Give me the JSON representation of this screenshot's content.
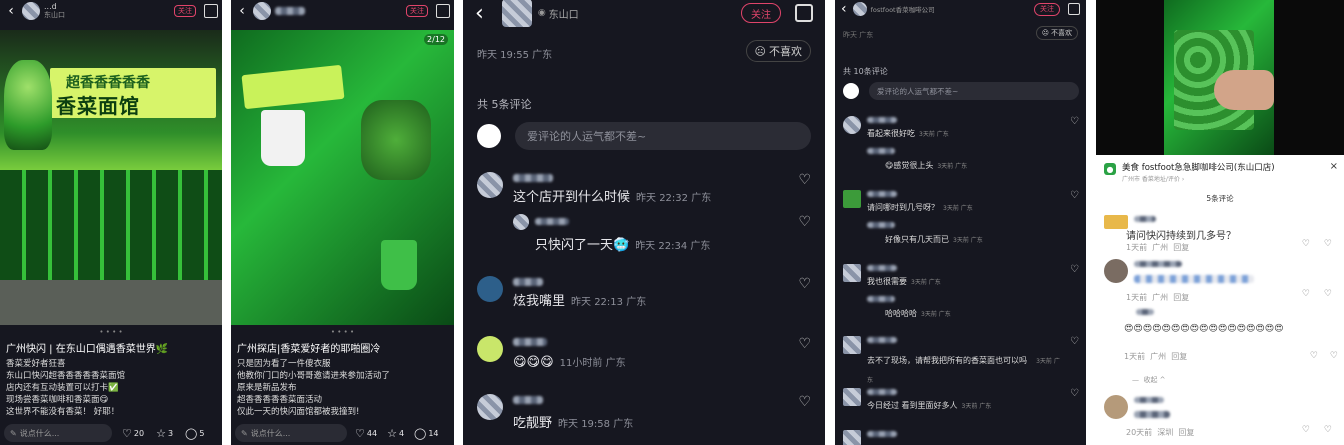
{
  "p1": {
    "username": "...d",
    "sub": "东山口",
    "follow": "关注",
    "sign_top": "超香香香香香",
    "sign_main": "香菜面馆",
    "caption_title": "广州快闪 | 在东山口偶遇香菜世界🌿",
    "lines": [
      "香菜爱好者狂喜",
      "东山口快闪超香香香香香菜面馆",
      "店内还有互动装置可以打卡✅",
      "现场尝香菜咖啡和香菜面😋",
      "这世界不能没有香菜！ 好耶！"
    ],
    "input": "说点什么...",
    "likes": "20",
    "stars": "3",
    "comments": "5"
  },
  "p2": {
    "follow": "关注",
    "page": "2/12",
    "caption_title": "广州探店|香菜爱好者的耶啪圈冷",
    "lines": [
      "只是因为看了一件傻衣服",
      "他教你门口的小哥哥邀请进来参加活动了",
      "原来是新品发布",
      "超香香香香香菜面活动",
      "仅此一天的快闪面馆都被我撞到!"
    ],
    "input": "说点什么...",
    "likes": "44",
    "stars": "4",
    "comments": "14"
  },
  "p3": {
    "location": "东山口",
    "follow": "关注",
    "time": "昨天 19:55 广东",
    "dislike": "不喜欢",
    "count": "共 5条评论",
    "placeholder": "爱评论的人运气都不差~",
    "comments": [
      {
        "text": "这个店开到什么时候",
        "meta": "昨天 22:32 广东"
      },
      {
        "text": "只快闪了一天🥶",
        "meta": "昨天 22:34 广东"
      },
      {
        "text": "炫我嘴里",
        "meta": "昨天 22:13 广东"
      },
      {
        "text": "😋😋😋",
        "meta": "11小时前 广东"
      },
      {
        "text": "吃靓野",
        "meta": "昨天 19:58 广东"
      }
    ]
  },
  "p4": {
    "follow": "关注",
    "dislike": "不喜欢",
    "title_line": "fostfoot香菜咖啡公司",
    "time": "昨天 广东",
    "count": "共 10条评论",
    "placeholder": "爱评论的人运气都不差~",
    "comments": [
      {
        "text": "看起来很好吃",
        "meta": "3天前 广东"
      },
      {
        "text": "😋感觉很上头",
        "meta": "3天前 广东"
      },
      {
        "text": "请问哪时到几号呀？",
        "meta": "3天前 广东"
      },
      {
        "text": "好像只有几天而已",
        "meta": "3天前 广东"
      },
      {
        "text": "我也很需要",
        "meta": "3天前 广东"
      },
      {
        "text": "哈哈哈哈",
        "meta": "3天前 广东"
      },
      {
        "text": "去不了现场，请帮我把所有的香菜面也可以吗",
        "meta": "3天前 广东"
      },
      {
        "text": "今日经过 看到里面好多人",
        "meta": "3天前 广东"
      }
    ]
  },
  "p5": {
    "shop": "美食  fostfoot急急脚咖啡公司(东山口店)",
    "shop_sub": "广州市  香菜地址/评价 ›",
    "count": "5条评论",
    "c1_text": "请问快闪持续到几多号？",
    "c1_meta": "1天前  广州  回复",
    "c2_meta": "1天前  广州  回复",
    "c3_text": "😍😍😍😍😍😍😍😍😍😍😍😍😍😍😍😍😍",
    "c3_meta": "1天前  广州  回复",
    "more": "—  收起 ^",
    "c4_meta": "20天前  深圳  回复"
  }
}
